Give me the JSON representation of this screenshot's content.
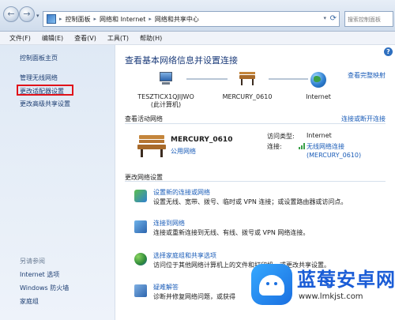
{
  "window": {
    "breadcrumbs": [
      "控制面板",
      "网络和 Internet",
      "网络和共享中心"
    ],
    "search_placeholder": "搜索控制面板"
  },
  "menu": [
    "文件(F)",
    "编辑(E)",
    "查看(V)",
    "工具(T)",
    "帮助(H)"
  ],
  "sidebar": {
    "items": [
      "控制面板主页",
      "管理无线网络",
      "更改适配器设置",
      "更改高级共享设置"
    ],
    "see_also_heading": "另请参阅",
    "see_also": [
      "Internet 选项",
      "Windows 防火墙",
      "家庭组"
    ]
  },
  "main": {
    "title": "查看基本网络信息并设置连接",
    "full_map": "查看完整映射",
    "nodes": [
      {
        "name": "TESZTICX1QJIJWO",
        "sub": "(此计算机)"
      },
      {
        "name": "MERCURY_0610",
        "sub": ""
      },
      {
        "name": "Internet",
        "sub": ""
      }
    ],
    "active_heading": "查看活动网络",
    "connect_disconnect": "连接或断开连接",
    "active_network": {
      "name": "MERCURY_0610",
      "type": "公用网络",
      "access_label": "访问类型:",
      "access_value": "Internet",
      "connection_label": "连接:",
      "connection_value": "无线网络连接",
      "connection_value2": "(MERCURY_0610)"
    },
    "change_heading": "更改网络设置",
    "tasks": [
      {
        "icon": "new-connection-icon",
        "title": "设置新的连接或网络",
        "desc": "设置无线、宽带、拨号、临时或 VPN 连接；或设置路由器或访问点。"
      },
      {
        "icon": "connect-network-icon",
        "title": "连接到网络",
        "desc": "连接或重新连接到无线、有线、拨号或 VPN 网络连接。"
      },
      {
        "icon": "homegroup-icon",
        "title": "选择家庭组和共享选项",
        "desc": "访问位于其他网络计算机上的文件和打印机，或更改共享设置。"
      },
      {
        "icon": "troubleshoot-icon",
        "title": "疑难解答",
        "desc": "诊断并修复网络问题，或获得"
      }
    ]
  },
  "watermark": {
    "title": "蓝莓安卓网",
    "url": "www.lmkjst.com"
  }
}
